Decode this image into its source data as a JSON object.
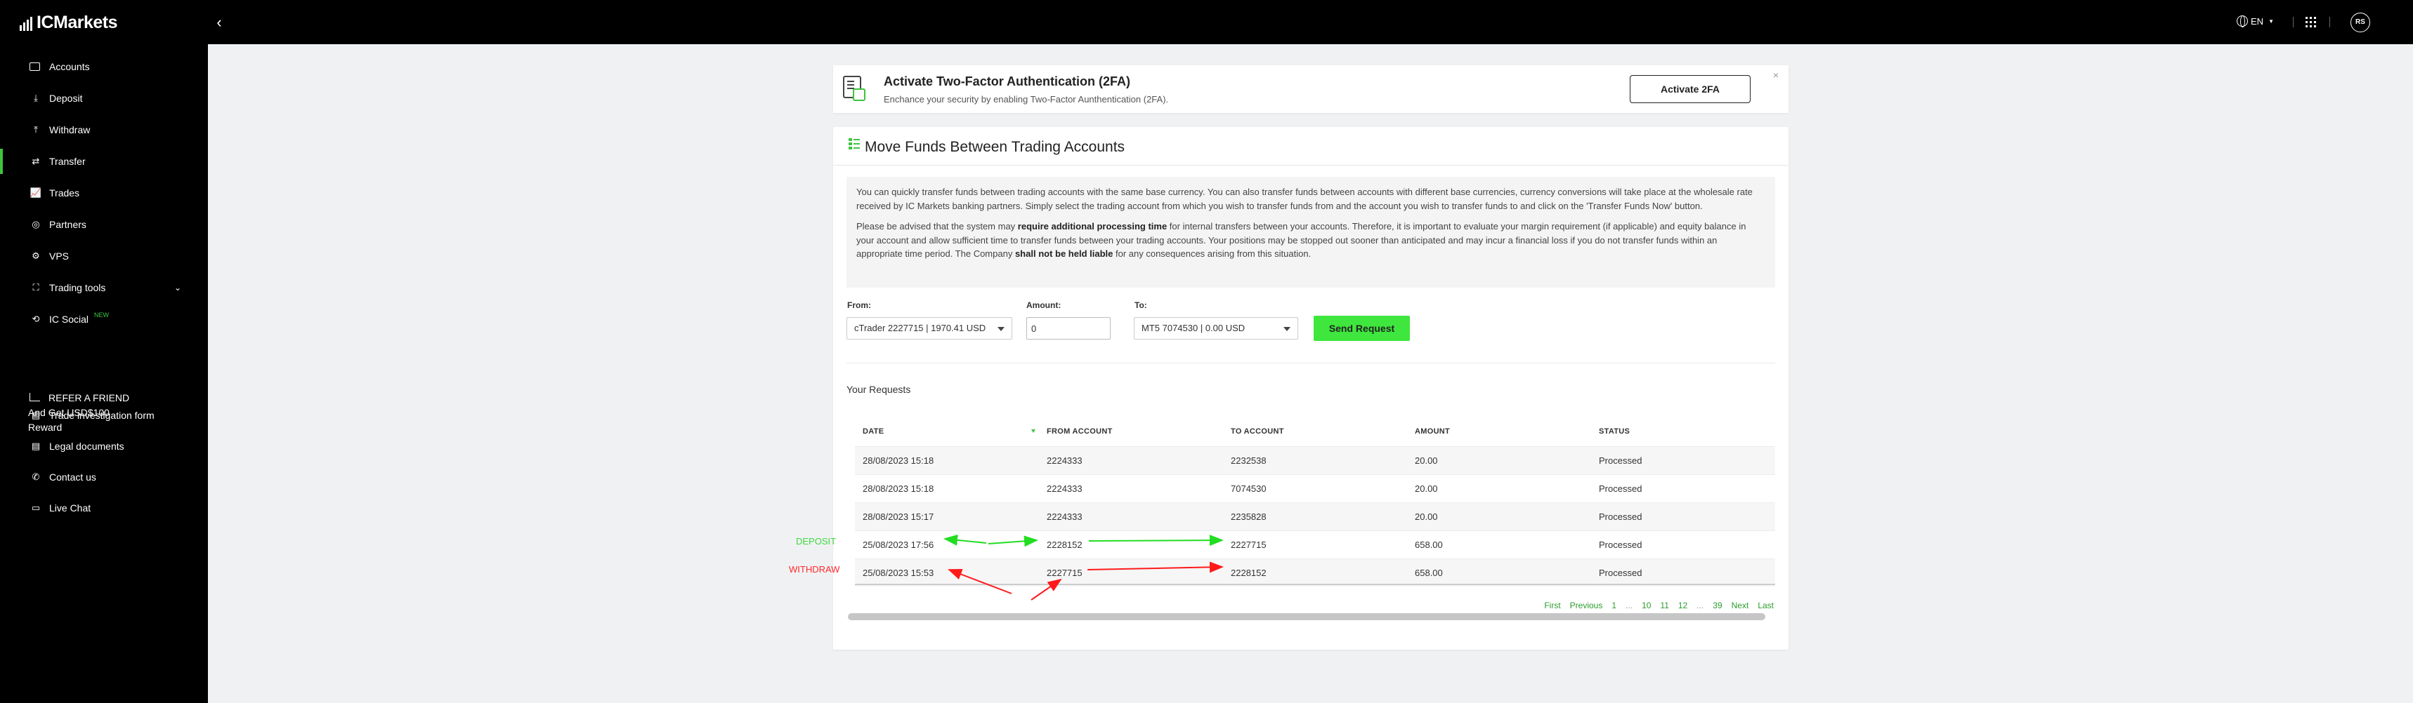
{
  "brand": {
    "logo_text": "ICMarkets"
  },
  "topbar": {
    "language": "EN",
    "avatar_initials": "RS"
  },
  "sidebar": {
    "items": [
      {
        "label": "Accounts"
      },
      {
        "label": "Deposit"
      },
      {
        "label": "Withdraw"
      },
      {
        "label": "Transfer"
      },
      {
        "label": "Trades"
      },
      {
        "label": "Partners"
      },
      {
        "label": "VPS"
      },
      {
        "label": "Trading tools"
      },
      {
        "label": "IC Social",
        "badge": "NEW"
      },
      {
        "label": "Trade investigation form"
      },
      {
        "label": "Legal documents"
      },
      {
        "label": "Contact us"
      },
      {
        "label": "Live Chat"
      }
    ],
    "refer": {
      "line1": "REFER A FRIEND",
      "line2": "And Get USD$100",
      "line3": "Reward"
    }
  },
  "twofa": {
    "title": "Activate Two-Factor Authentication (2FA)",
    "subtitle": "Enchance your security by enabling Two-Factor Aunthentication (2FA).",
    "button": "Activate 2FA",
    "close": "×"
  },
  "transfer": {
    "title": "Move Funds Between Trading Accounts",
    "info_p1": "You can quickly transfer funds between trading accounts with the same base currency. You can also transfer funds between accounts with different base currencies, currency conversions will take place at the wholesale rate received by IC Markets banking partners. Simply select the trading account from which you wish to transfer funds from and the account you wish to transfer funds to and click on the 'Transfer Funds Now' button.",
    "info_p2_a": "Please be advised that the system may ",
    "info_p2_b": "require additional processing time",
    "info_p2_c": " for internal transfers between your accounts. Therefore, it is important to evaluate your margin requirement (if applicable) and equity balance in your account and allow sufficient time to transfer funds between your trading accounts. Your positions may be stopped out sooner than anticipated and may incur a financial loss if you do not transfer funds within an appropriate time period. The Company ",
    "info_p2_d": "shall not be held liable",
    "info_p2_e": " for any consequences arising from this situation.",
    "from_label": "From:",
    "from_value": "cTrader 2227715 | 1970.41 USD",
    "amount_label": "Amount:",
    "amount_value": "0",
    "to_label": "To:",
    "to_value": "MT5 7074530 | 0.00 USD",
    "send_button": "Send Request"
  },
  "requests": {
    "title": "Your Requests",
    "columns": [
      "DATE",
      "FROM ACCOUNT",
      "TO ACCOUNT",
      "AMOUNT",
      "STATUS"
    ],
    "rows": [
      [
        "28/08/2023 15:18",
        "2224333",
        "2232538",
        "20.00",
        "Processed"
      ],
      [
        "28/08/2023 15:18",
        "2224333",
        "7074530",
        "20.00",
        "Processed"
      ],
      [
        "28/08/2023 15:17",
        "2224333",
        "2235828",
        "20.00",
        "Processed"
      ],
      [
        "25/08/2023 17:56",
        "2228152",
        "2227715",
        "658.00",
        "Processed"
      ],
      [
        "25/08/2023 15:53",
        "2227715",
        "2228152",
        "658.00",
        "Processed"
      ]
    ],
    "pager": [
      "First",
      "Previous",
      "1",
      "...",
      "10",
      "11",
      "12",
      "...",
      "39",
      "Next",
      "Last"
    ]
  },
  "annotations": {
    "deposit": "DEPOSIT",
    "withdraw": "WITHDRAW",
    "deposit_color": "#3ed83e",
    "withdraw_color": "#ff2a2a"
  },
  "colors": {
    "accent": "#3ec43e",
    "button_green": "#3ee63e",
    "sidebar_bg": "#000000",
    "page_bg": "#f0f1f3"
  }
}
